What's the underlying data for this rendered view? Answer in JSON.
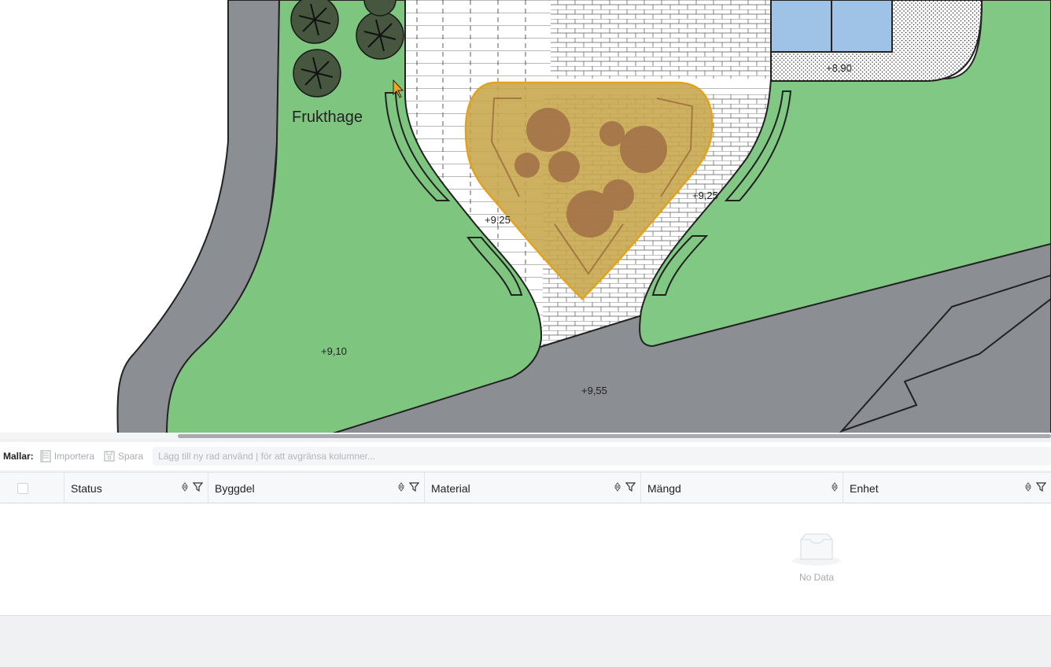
{
  "plan": {
    "area_label": "Frukthage",
    "elevations": [
      "+9,25",
      "+9,25",
      "+9,10",
      "+9,55",
      "+8,90"
    ]
  },
  "toolbar": {
    "templates_label": "Mallar:",
    "import_label": "Importera",
    "save_label": "Spara",
    "filter_placeholder": "Lägg till ny rad använd | för att avgränsa kolumner..."
  },
  "table": {
    "columns": [
      "Status",
      "Byggdel",
      "Material",
      "Mängd",
      "Enhet"
    ],
    "rows": [],
    "empty_text": "No Data"
  },
  "colors": {
    "lawn": "#7cc47f",
    "road": "#8a8d91",
    "selection": "#c8a84a",
    "water": "#9ec3e6"
  }
}
